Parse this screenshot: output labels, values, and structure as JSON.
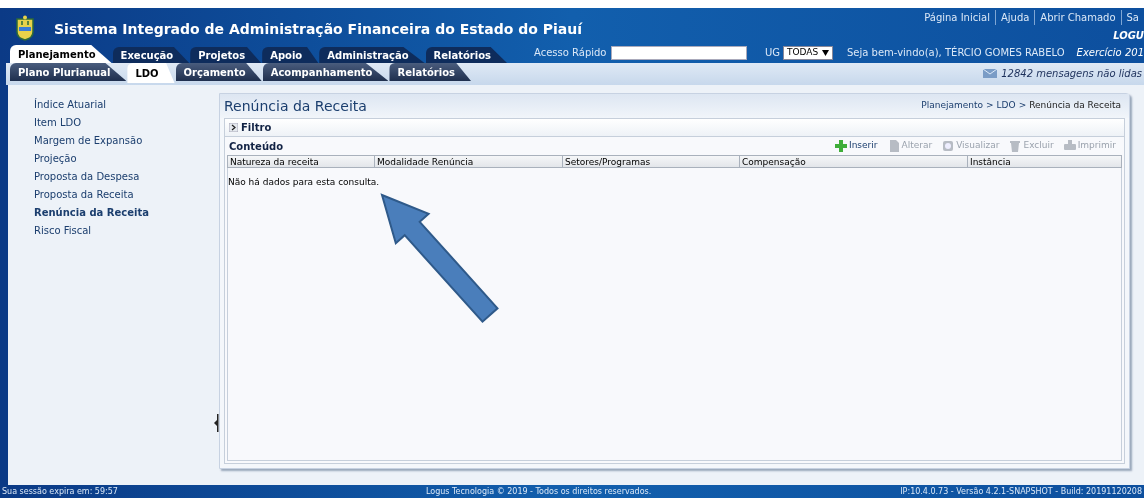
{
  "header": {
    "title": "Sistema Integrado de Administração Financeira do Estado do Piauí",
    "links": [
      "Página Inicial",
      "Ajuda",
      "Abrir Chamado",
      "Sa"
    ],
    "brand": "LOGU"
  },
  "main_tabs": [
    {
      "label": "Planejamento",
      "selected": true
    },
    {
      "label": "Execução",
      "selected": false
    },
    {
      "label": "Projetos",
      "selected": false
    },
    {
      "label": "Apoio",
      "selected": false
    },
    {
      "label": "Administração",
      "selected": false
    },
    {
      "label": "Relatórios",
      "selected": false
    }
  ],
  "quick_access": {
    "label": "Acesso Rápido"
  },
  "ug": {
    "label": "UG",
    "value": "TODAS"
  },
  "welcome": "Seja bem-vindo(a), TÉRCIO GOMES RABELO",
  "exercise": "Exercício 201",
  "sub_tabs": [
    {
      "label": "Plano Plurianual",
      "selected": false
    },
    {
      "label": "LDO",
      "selected": true
    },
    {
      "label": "Orçamento",
      "selected": false
    },
    {
      "label": "Acompanhamento",
      "selected": false
    },
    {
      "label": "Relatórios",
      "selected": false
    }
  ],
  "messages": "12842 mensagens não lidas",
  "sidebar": {
    "items": [
      {
        "label": "Índice Atuarial",
        "selected": false
      },
      {
        "label": "Item LDO",
        "selected": false
      },
      {
        "label": "Margem de Expansão",
        "selected": false
      },
      {
        "label": "Projeção",
        "selected": false
      },
      {
        "label": "Proposta da Despesa",
        "selected": false
      },
      {
        "label": "Proposta da Receita",
        "selected": false
      },
      {
        "label": "Renúncia da Receita",
        "selected": true
      },
      {
        "label": "Risco Fiscal",
        "selected": false
      }
    ]
  },
  "page": {
    "title": "Renúncia da Receita",
    "breadcrumb": [
      "Planejamento",
      "LDO",
      "Renúncia da Receita"
    ],
    "separator": ">"
  },
  "filter": {
    "label": "Filtro",
    "expanded": false
  },
  "content": {
    "title": "Conteúdo",
    "toolbar": [
      {
        "label": "Inserir",
        "kind": "plus",
        "disabled": false
      },
      {
        "label": "Alterar",
        "kind": "page",
        "disabled": true
      },
      {
        "label": "Visualizar",
        "kind": "magnifier",
        "disabled": true
      },
      {
        "label": "Excluir",
        "kind": "trash",
        "disabled": true
      },
      {
        "label": "Imprimir",
        "kind": "printer",
        "disabled": true
      }
    ],
    "table": {
      "columns": [
        "Natureza da receita",
        "Modalidade Renúncia",
        "Setores/Programas",
        "Compensação",
        "Instância"
      ],
      "empty_message": "Não há dados para esta consulta."
    }
  },
  "status_bar": {
    "session": "Sua sessão expira em: 59:57",
    "copyright": "Logus Tecnologia © 2019 - Todos os direitos reservados.",
    "build": "IP:10.4.0.73 - Versão 4.2.1-SNAPSHOT - Build: 20191120208"
  }
}
